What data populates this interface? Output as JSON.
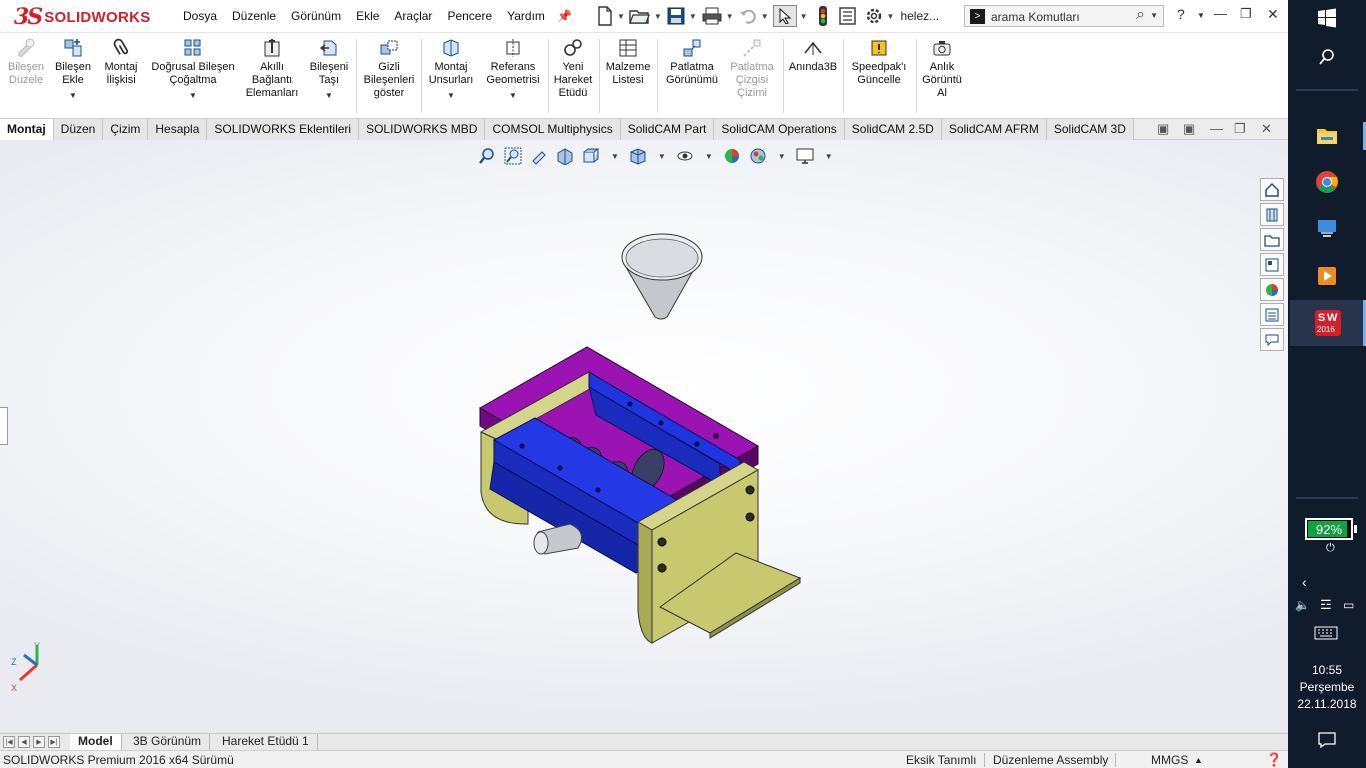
{
  "app": {
    "brand_prefix": "3S",
    "brand_name": "SOLIDWORKS",
    "menus": [
      "Dosya",
      "Düzenle",
      "Görünüm",
      "Ekle",
      "Araçlar",
      "Pencere",
      "Yardım"
    ],
    "doc_name": "helez...",
    "search_placeholder": "arama Komutları",
    "help": "?"
  },
  "ribbon": {
    "items": [
      {
        "label": "Bileşen Düzele",
        "disabled": true
      },
      {
        "label": "Bileşen Ekle",
        "disabled": false
      },
      {
        "label": "Montaj İlişkisi",
        "disabled": false
      },
      {
        "label": "Doğrusal Bileşen Çoğaltma",
        "disabled": false
      },
      {
        "label": "Akıllı Bağlantı Elemanları",
        "disabled": false
      },
      {
        "label": "Bileşeni Taşı",
        "disabled": false
      },
      {
        "label": "Gizli Bileşenleri göster",
        "disabled": false
      },
      {
        "label": "Montaj Unsurları",
        "disabled": false
      },
      {
        "label": "Referans Geometrisi",
        "disabled": false
      },
      {
        "label": "Yeni Hareket Etüdü",
        "disabled": false
      },
      {
        "label": "Malzeme Listesi",
        "disabled": false
      },
      {
        "label": "Patlatma Görünümü",
        "disabled": false
      },
      {
        "label": "Patlatma Çizgisi Çizimi",
        "disabled": true
      },
      {
        "label": "Anında3B",
        "disabled": false
      },
      {
        "label": "Speedpak'ı Güncelle",
        "disabled": false
      },
      {
        "label": "Anlık Görüntü Al",
        "disabled": false
      }
    ]
  },
  "tabs": [
    "Montaj",
    "Düzen",
    "Çizim",
    "Hesapla",
    "SOLIDWORKS Eklentileri",
    "SOLIDWORKS MBD",
    "COMSOL Multiphysics",
    "SolidCAM Part",
    "SolidCAM Operations",
    "SolidCAM 2.5D",
    "SolidCAM AFRM",
    "SolidCAM 3D"
  ],
  "active_tab": "Montaj",
  "triad": {
    "x": "X",
    "y": "Y",
    "z": "Z"
  },
  "bottom_tabs": [
    "Model",
    "3B Görünüm",
    "Hareket Etüdü 1"
  ],
  "status": {
    "version": "SOLIDWORKS Premium 2016 x64 Sürümü",
    "definition": "Eksik Tanımlı",
    "mode": "Düzenleme Assembly",
    "units": "MMGS"
  },
  "taskbar": {
    "battery_percent": "92%",
    "battery_level": 0.92,
    "time": "10:55",
    "day": "Perşembe",
    "date": "22.11.2018",
    "sw_badge": "2016"
  },
  "colors": {
    "plate": "#8b0d9e",
    "housing": "#c8c96e",
    "channel": "#1d2fd6",
    "auger": "#1fc48a",
    "accent_red": "#d0212b",
    "taskbar": "#101b2b"
  }
}
